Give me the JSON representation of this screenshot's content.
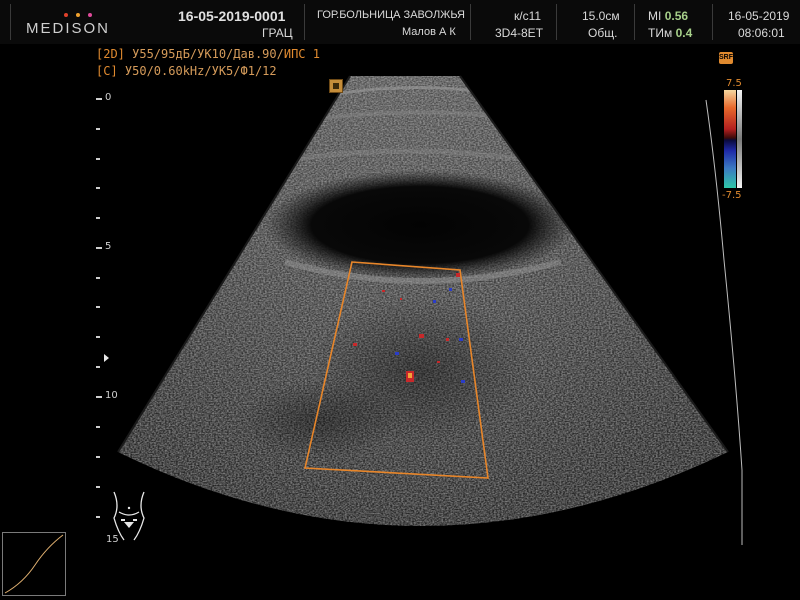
{
  "header": {
    "brand": "MEDISON",
    "brand_dots": [
      "#e0412b",
      "#f0a12e",
      "#e04a9a"
    ],
    "patient_id": "16-05-2019-0001",
    "patient_sub": "ГРАЦ",
    "hospital": "ГОР.БОЛЬНИЦА ЗАВОЛЖЬЯ",
    "operator": "Малов А К",
    "exam": "к/с11",
    "probe": "3D4-8ET",
    "depth": "15.0см",
    "preset": "Общ.",
    "mi_label": "MI",
    "mi_value": "0.56",
    "tim_label": "ТИм",
    "tim_value": "0.4",
    "date": "16-05-2019",
    "time": "08:06:01"
  },
  "params": {
    "line1_tag": "[2D]",
    "line1_text": " У55/95дБ/УК10/Дав.90/",
    "line1_hi": "ИПС 1",
    "line2_tag": "[C]",
    "line2_text": " У50/0.60kHz/УК5/Ф1/12"
  },
  "scale": {
    "labels": [
      "0",
      "5",
      "10",
      "15"
    ]
  },
  "colorbar": {
    "top": "7.5",
    "bottom": "-7.5",
    "badge": "SRF"
  },
  "colors": {
    "roi_box": "#e8862a",
    "doppler_red": "#c8282a",
    "doppler_blue": "#2a3cc8"
  }
}
